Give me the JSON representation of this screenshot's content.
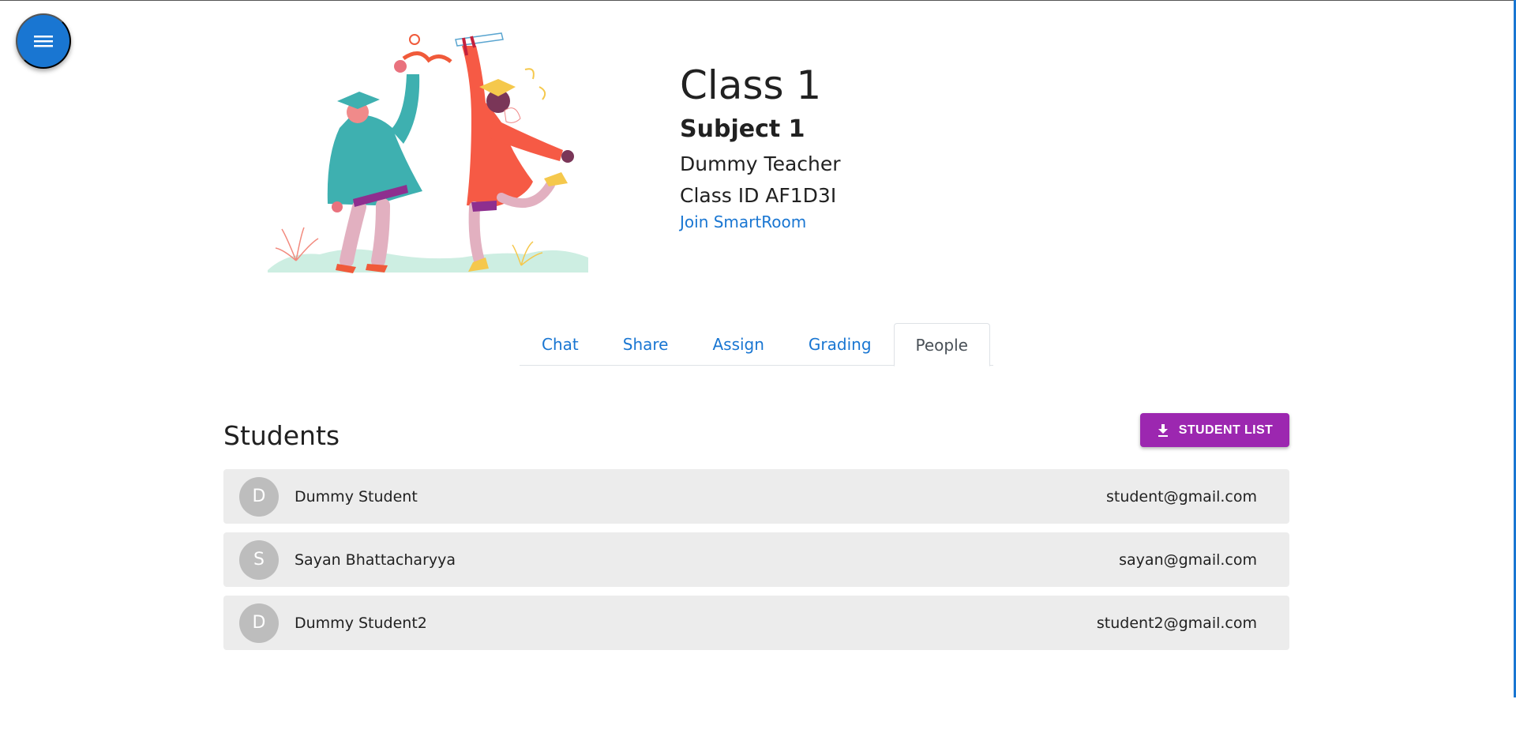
{
  "header": {
    "menu_icon": "hamburger-menu-icon",
    "illustration": "graduation-celebration-illustration"
  },
  "class_info": {
    "title": "Class 1",
    "subject": "Subject 1",
    "teacher": "Dummy Teacher",
    "class_id": "Class ID AF1D3I",
    "join_link": "Join SmartRoom"
  },
  "tabs": [
    {
      "label": "Chat",
      "active": false
    },
    {
      "label": "Share",
      "active": false
    },
    {
      "label": "Assign",
      "active": false
    },
    {
      "label": "Grading",
      "active": false
    },
    {
      "label": "People",
      "active": true
    }
  ],
  "students": {
    "heading": "Students",
    "download_button": {
      "label": "STUDENT LIST",
      "icon": "download-icon"
    },
    "rows": [
      {
        "initial": "D",
        "name": "Dummy Student",
        "email": "student@gmail.com"
      },
      {
        "initial": "S",
        "name": "Sayan Bhattacharyya",
        "email": "sayan@gmail.com"
      },
      {
        "initial": "D",
        "name": "Dummy Student2",
        "email": "student2@gmail.com"
      }
    ]
  },
  "colors": {
    "primary": "#1976d2",
    "download_button": "#9c27b0",
    "row_background": "#ececec",
    "avatar": "#bdbdbd"
  }
}
